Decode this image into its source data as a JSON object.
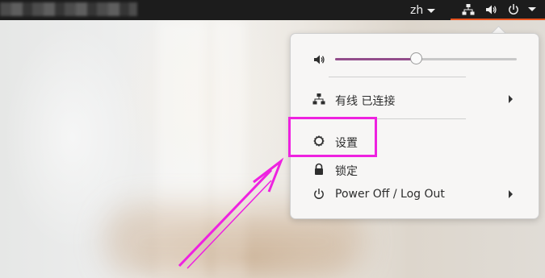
{
  "topbar": {
    "language": "zh",
    "icons": [
      "network-icon",
      "volume-icon",
      "power-icon",
      "chevron-down-icon"
    ]
  },
  "system_menu": {
    "volume": {
      "icon": "volume-icon",
      "level": 0.45
    },
    "items": [
      {
        "icon": "network-icon",
        "label": "有线 已连接",
        "submenu": true
      },
      {
        "icon": "settings-icon",
        "label": "设置",
        "submenu": false
      },
      {
        "icon": "lock-icon",
        "label": "锁定",
        "submenu": false
      },
      {
        "icon": "power-icon",
        "label": "Power Off / Log Out",
        "submenu": true
      }
    ]
  },
  "annotation": {
    "highlight_color": "#ee22e0",
    "target": "设置"
  },
  "colors": {
    "topbar": "#1c1c1c",
    "slider": "#924d8b",
    "accent": "#e95420",
    "menu_bg": "#f7f6f5"
  }
}
